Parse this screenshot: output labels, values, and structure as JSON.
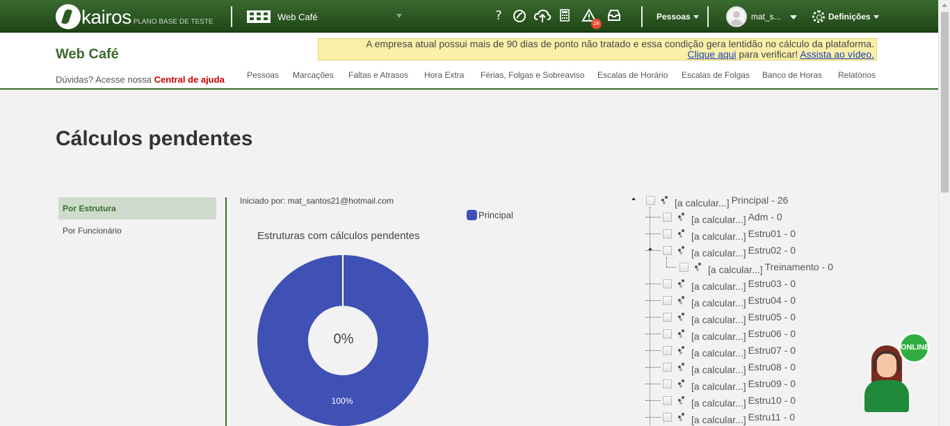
{
  "header": {
    "logo_text": "kairos",
    "plan_label": "PLANO BASE DE TESTE",
    "company_name": "Web Café",
    "icons": [
      "help-icon",
      "ponto-icon",
      "cloud-upload-icon",
      "calculator-icon",
      "warning-icon",
      "inbox-icon"
    ],
    "help_glyph": "?",
    "notification_count": "26",
    "pessoas_label": "Pessoas",
    "user_name": "mat_s...",
    "settings_label": "Definições"
  },
  "subheader": {
    "brand_title": "Web Café",
    "help_prefix": "Dúvidas? Acesse nossa",
    "help_link": "Central de ajuda",
    "alert_text": "A empresa atual possui mais de 90 dias de ponto não tratado e essa condição gera lentidão no cálculo da plataforma.",
    "alert_link1": "Clique aqui",
    "alert_mid": "para verificar!",
    "alert_link2": "Assista ao vídeo.",
    "nav": [
      "Pessoas",
      "Marcações",
      "Faltas e Atrasos",
      "Hora Extra",
      "Férias, Folgas e Sobreaviso",
      "Escalas de Horário",
      "Escalas de Folgas",
      "Banco de Horas",
      "Relatórios"
    ]
  },
  "page": {
    "title": "Cálculos pendentes",
    "tabs": [
      "Por Estrutura",
      "Por Funcionário"
    ],
    "active_tab": "Por Estrutura",
    "started_by": "Iniciado por: mat_santos21@hotmail.com"
  },
  "chart_data": {
    "type": "pie",
    "title": "Estruturas com cálculos pendentes",
    "legend": [
      "Principal"
    ],
    "center_label": "0%",
    "slices": [
      {
        "label": "Principal",
        "value": 100,
        "display": "100%",
        "color": "#3f51b5"
      }
    ]
  },
  "tree": {
    "calc_label": "[a calcular...]",
    "nodes": [
      {
        "label": "Principal - 26",
        "level": 0
      },
      {
        "label": "Adm - 0",
        "level": 1
      },
      {
        "label": "Estru01 - 0",
        "level": 1
      },
      {
        "label": "Estru02 - 0",
        "level": 1
      },
      {
        "label": "Treinamento - 0",
        "level": 2
      },
      {
        "label": "Estru03 - 0",
        "level": 1
      },
      {
        "label": "Estru04 - 0",
        "level": 1
      },
      {
        "label": "Estru05 - 0",
        "level": 1
      },
      {
        "label": "Estru06 - 0",
        "level": 1
      },
      {
        "label": "Estru07 - 0",
        "level": 1
      },
      {
        "label": "Estru08 - 0",
        "level": 1
      },
      {
        "label": "Estru09 - 0",
        "level": 1
      },
      {
        "label": "Estru10 - 0",
        "level": 1
      },
      {
        "label": "Estru11 - 0",
        "level": 1
      }
    ]
  },
  "chat": {
    "online_label": "ONLINE"
  }
}
